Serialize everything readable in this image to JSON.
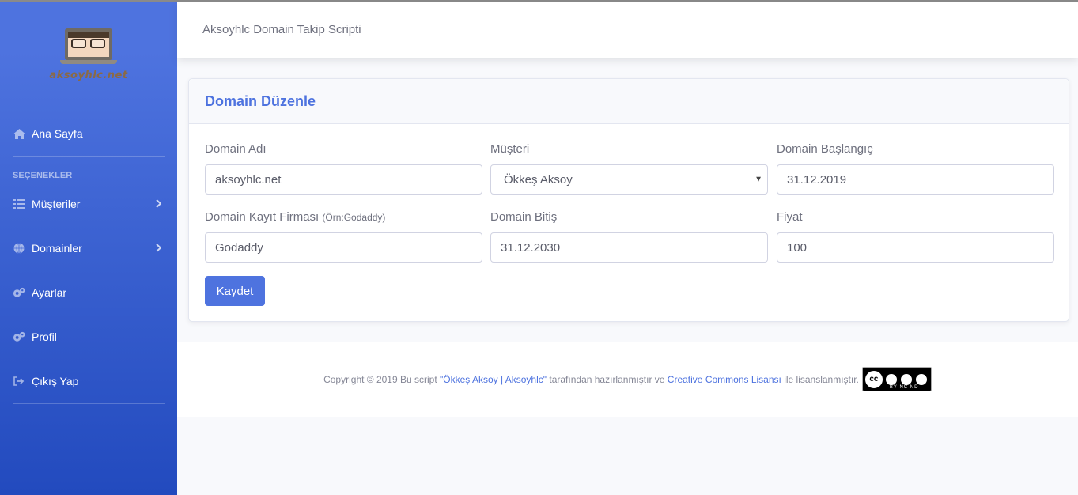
{
  "brand": {
    "logo_text": "aksoyhlc.net"
  },
  "sidebar": {
    "items": [
      {
        "label": "Ana Sayfa",
        "icon": "home-icon"
      },
      {
        "label": "Müşteriler",
        "icon": "list-icon"
      },
      {
        "label": "Domainler",
        "icon": "globe-icon"
      },
      {
        "label": "Ayarlar",
        "icon": "cogs-icon"
      },
      {
        "label": "Profil",
        "icon": "cogs-icon"
      },
      {
        "label": "Çıkış Yap",
        "icon": "sign-out-icon"
      }
    ],
    "heading": "SEÇENEKLER"
  },
  "topbar": {
    "title": "Aksoyhlc Domain Takip Scripti"
  },
  "card": {
    "title": "Domain Düzenle",
    "fields": {
      "domain_name": {
        "label": "Domain Adı",
        "value": "aksoyhlc.net"
      },
      "customer": {
        "label": "Müşteri",
        "value": "Ökkeş Aksoy"
      },
      "start": {
        "label": "Domain Başlangıç",
        "value": "31.12.2019"
      },
      "registrar": {
        "label": "Domain Kayıt Firması",
        "hint": "(Örn:Godaddy)",
        "value": "Godaddy"
      },
      "end": {
        "label": "Domain Bitiş",
        "value": "31.12.2030"
      },
      "price": {
        "label": "Fiyat",
        "value": "100"
      }
    },
    "save_label": "Kaydet"
  },
  "footer": {
    "prefix": "Copyright © 2019 Bu script ",
    "author_link": "\"Ökkeş Aksoy | Aksoyhlc\"",
    "middle": " tarafından hazırlanmıştır ve ",
    "license_link": "Creative Commons Lisansı",
    "suffix": " ile lisanslanmıştır.",
    "badge_tags": "BY NC ND"
  }
}
